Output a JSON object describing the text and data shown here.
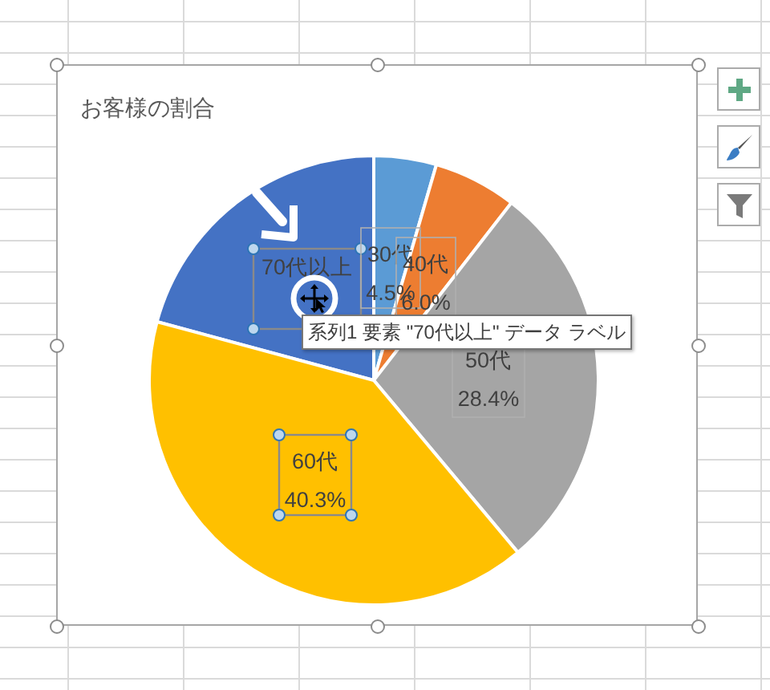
{
  "chart": {
    "title": "お客様の割合",
    "chart_data": {
      "type": "pie",
      "categories": [
        "70代以上",
        "30代",
        "40代",
        "50代",
        "60代"
      ],
      "series": [
        {
          "values": [
            20.8,
            4.5,
            6.0,
            28.4,
            40.3
          ]
        }
      ],
      "colors": [
        "#4472c4",
        "#5b9bd5",
        "#ed7d31",
        "#a5a5a5",
        "#ffc000"
      ]
    },
    "data_labels": [
      {
        "selected": true
      },
      {
        "value": "4.5%",
        "selected": false
      },
      {
        "value": "6.0%",
        "selected": false
      },
      {
        "value": "28.4%",
        "selected": false
      },
      {
        "value": "40.3%",
        "selected": true
      }
    ],
    "tooltip": "系列1 要素 \"70代以上\" データ ラベル"
  },
  "side_buttons": [
    {
      "kind": "add"
    },
    {
      "kind": "style"
    },
    {
      "kind": "filter"
    }
  ]
}
